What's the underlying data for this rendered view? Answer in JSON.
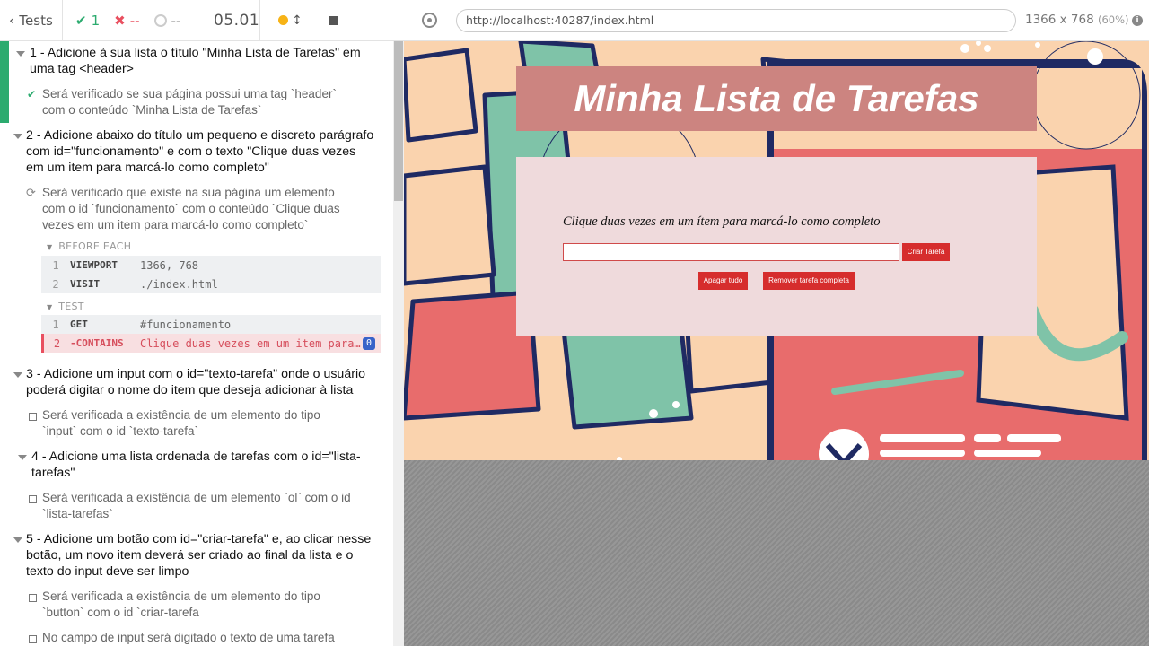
{
  "header": {
    "tests_label": "Tests",
    "passed_count": "1",
    "failed_count": "--",
    "pending_count": "--",
    "duration": "05.01"
  },
  "suites": [
    {
      "title": "1 - Adicione à sua lista o título \"Minha Lista de Tarefas\" em uma tag <header>",
      "tests": [
        {
          "title": "Será verificado se sua página possui uma tag `header` com o conteúdo `Minha Lista de Tarefas`",
          "state": "passed"
        }
      ]
    },
    {
      "title": "2 - Adicione abaixo do título um pequeno e discreto parágrafo com id=\"funcionamento\" e com o texto \"Clique duas vezes em um item para marcá-lo como completo\"",
      "tests": [
        {
          "title": "Será verificado que existe na sua página um elemento com o id `funcionamento` com o conteúdo `Clique duas vezes em um item para marcá-lo como completo`",
          "state": "running"
        }
      ],
      "hooks": {
        "before_each_label": "BEFORE EACH",
        "before_each": [
          {
            "n": "1",
            "cmd": "VIEWPORT",
            "arg": "1366, 768"
          },
          {
            "n": "2",
            "cmd": "VISIT",
            "arg": "./index.html"
          }
        ],
        "test_label": "TEST",
        "test": [
          {
            "n": "1",
            "cmd": "GET",
            "arg": "#funcionamento"
          },
          {
            "n": "2",
            "cmd": "-CONTAINS",
            "arg": "Clique duas vezes em um item para marcá-lo como completo",
            "badge": "0"
          }
        ]
      }
    },
    {
      "title": "3 - Adicione um input com o id=\"texto-tarefa\" onde o usuário poderá digitar o nome do item que deseja adicionar à lista",
      "tests": [
        {
          "title": "Será verificada a existência de um elemento do tipo `input` com o id `texto-tarefa`",
          "state": "pending"
        }
      ]
    },
    {
      "title": "4 - Adicione uma lista ordenada de tarefas com o id=\"lista-tarefas\"",
      "tests": [
        {
          "title": "Será verificada a existência de um elemento `ol` com o id `lista-tarefas`",
          "state": "pending"
        }
      ]
    },
    {
      "title": "5 - Adicione um botão com id=\"criar-tarefa\" e, ao clicar nesse botão, um novo item deverá ser criado ao final da lista e o texto do input deve ser limpo",
      "tests": [
        {
          "title": "Será verificada a existência de um elemento do tipo `button` com o id `criar-tarefa",
          "state": "pending"
        },
        {
          "title": "No campo de input será digitado o texto de uma tarefa",
          "state": "pending"
        }
      ]
    }
  ],
  "browser": {
    "url": "http://localhost:40287/index.html",
    "viewport": "1366 x 768",
    "scale": "(60%)",
    "info_glyph": "i"
  },
  "app": {
    "title": "Minha Lista de Tarefas",
    "instructions": "Clique duas vezes em um ítem para marcá-lo como completo",
    "input_value": "",
    "create_button": "Criar Tarefa",
    "clear_all_button": "Apagar tudo",
    "remove_completed_button": "Remover tarefa completa",
    "colors": {
      "title_bg": "#cc8480",
      "card_bg": "#efdadc",
      "button_bg": "#d62d2d",
      "page_bg": "#fad3ae"
    }
  },
  "icons": [
    "chevron-left-icon",
    "check-icon",
    "x-icon",
    "spinner-icon",
    "sort-arrows-icon",
    "stop-icon",
    "target-icon",
    "info-icon",
    "caret-down-icon",
    "refresh-icon",
    "checkbox-icon"
  ]
}
